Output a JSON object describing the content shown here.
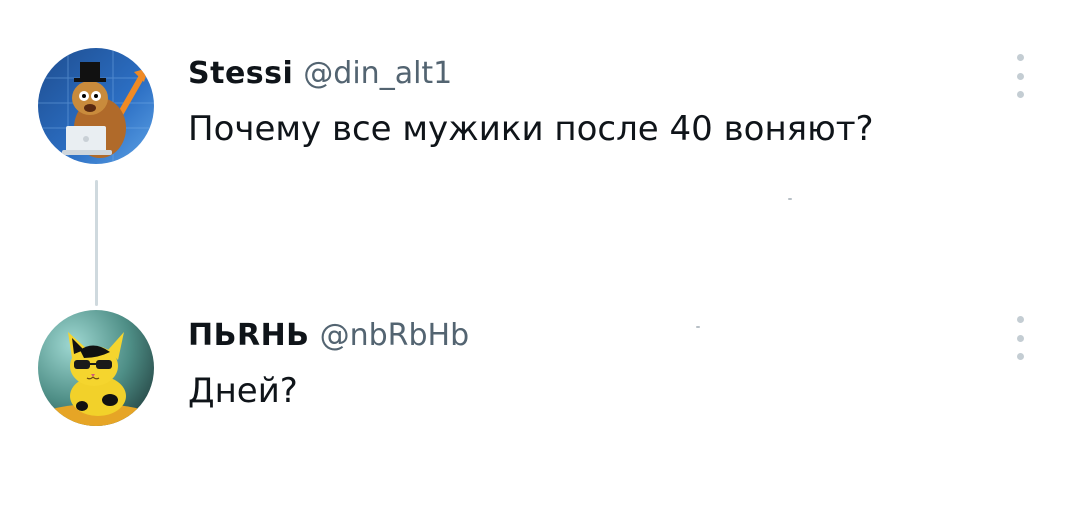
{
  "thread": [
    {
      "display_name": "Stessi",
      "handle": "@din_alt1",
      "text": "Почему все мужики после 40 воняют?",
      "avatar_icon": "cartoon-character-laptop-avatar",
      "more_icon": "more-vertical-icon"
    },
    {
      "display_name": "ПЬRНЬ",
      "handle": "@nbRbHb",
      "text": "Дней?",
      "avatar_icon": "cat-avatar",
      "more_icon": "more-vertical-icon"
    }
  ],
  "colors": {
    "text_primary": "#0f1419",
    "text_secondary": "#536471",
    "connector": "#cfd9de",
    "more_dots": "#c4cdd3"
  }
}
